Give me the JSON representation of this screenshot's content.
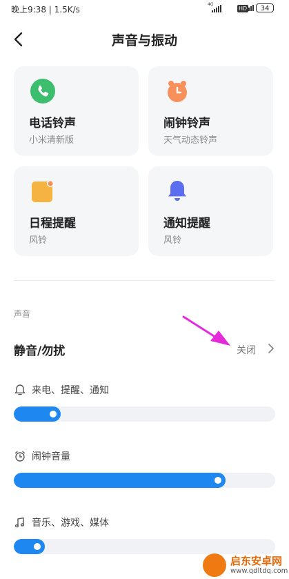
{
  "status": {
    "time_speed": "晚上9:38 | 1.5K/s",
    "battery": "34",
    "hd": "HD",
    "net": "4G"
  },
  "header": {
    "title": "声音与振动"
  },
  "cards": [
    {
      "name": "电话铃声",
      "sub": "小米清新版",
      "icon": "phone-icon",
      "color": "#3dbd6e"
    },
    {
      "name": "闹钟铃声",
      "sub": "天气动态铃声",
      "icon": "alarm-clock-icon",
      "color": "#f7905a"
    },
    {
      "name": "日程提醒",
      "sub": "风铃",
      "icon": "calendar-icon",
      "color": "#f5b442"
    },
    {
      "name": "通知提醒",
      "sub": "风铃",
      "icon": "bell-icon",
      "color": "#5b6ef0"
    }
  ],
  "sound": {
    "section_title": "声音",
    "mute": {
      "label": "静音/勿扰",
      "value": "关闭"
    },
    "volumes": [
      {
        "label": "来电、提醒、通知",
        "icon": "bell-outline-icon",
        "level": 0.18
      },
      {
        "label": "闹钟音量",
        "icon": "alarm-outline-icon",
        "level": 0.81
      },
      {
        "label": "音乐、游戏、媒体",
        "icon": "music-note-icon",
        "level": 0.12
      }
    ]
  },
  "watermark": {
    "title": "启东安卓网",
    "url": "www.qdltdq.com"
  },
  "colors": {
    "accent": "#1e88f0",
    "annotation_arrow": "#e42ad9"
  }
}
